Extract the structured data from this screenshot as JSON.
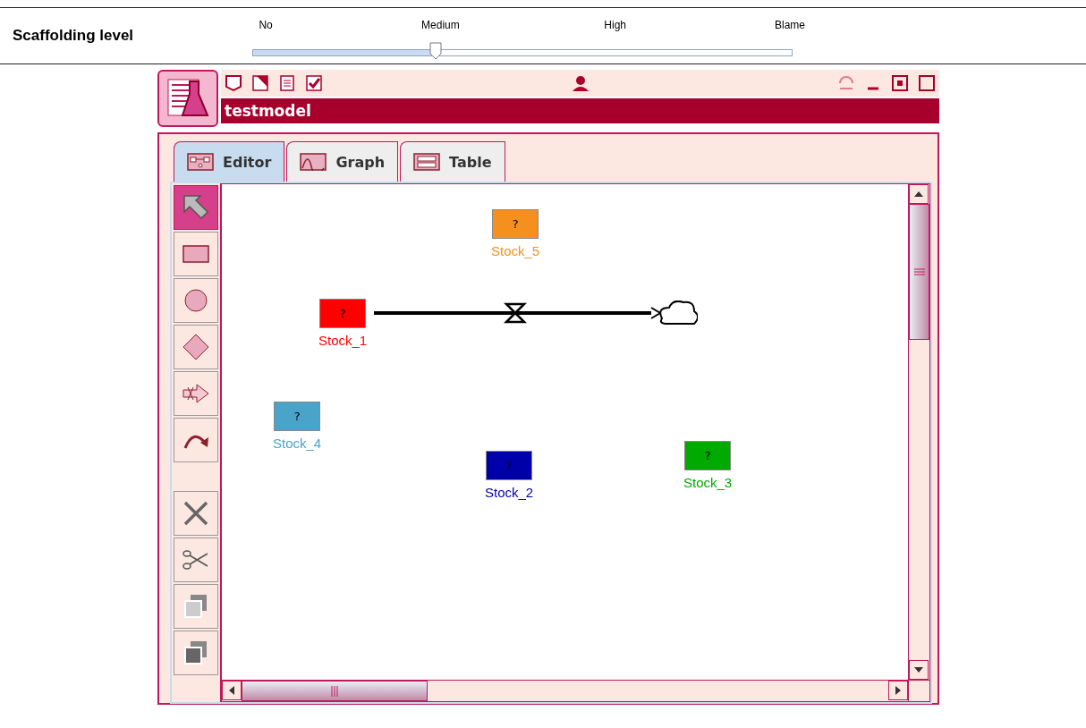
{
  "scaffolding": {
    "label": "Scaffolding level",
    "level": 0.34,
    "ticks": [
      "No",
      "Medium",
      "High",
      "Blame"
    ]
  },
  "window": {
    "title": "testmodel"
  },
  "tabs": [
    {
      "label": "Editor",
      "kind": "editor",
      "selected": true
    },
    {
      "label": "Graph",
      "kind": "graph",
      "selected": false
    },
    {
      "label": "Table",
      "kind": "table",
      "selected": false
    }
  ],
  "tools": [
    {
      "kind": "pointer",
      "selected": true
    },
    {
      "kind": "stock",
      "selected": false
    },
    {
      "kind": "auxiliary",
      "selected": false
    },
    {
      "kind": "constant",
      "selected": false
    },
    {
      "kind": "flow",
      "selected": false
    },
    {
      "kind": "relation",
      "selected": false
    },
    {
      "kind": "delete",
      "selected": false
    },
    {
      "kind": "cut",
      "selected": false
    },
    {
      "kind": "copy",
      "selected": false
    },
    {
      "kind": "paste",
      "selected": false
    }
  ],
  "stocks": [
    {
      "label": "Stock_5",
      "value": "?",
      "color": "#f5901e"
    },
    {
      "label": "Stock_1",
      "value": "?",
      "color": "#ff0000"
    },
    {
      "label": "Stock_4",
      "value": "?",
      "color": "#4aa3c8"
    },
    {
      "label": "Stock_2",
      "value": "?",
      "color": "#0000aa"
    },
    {
      "label": "Stock_3",
      "value": "?",
      "color": "#00aa00"
    }
  ]
}
